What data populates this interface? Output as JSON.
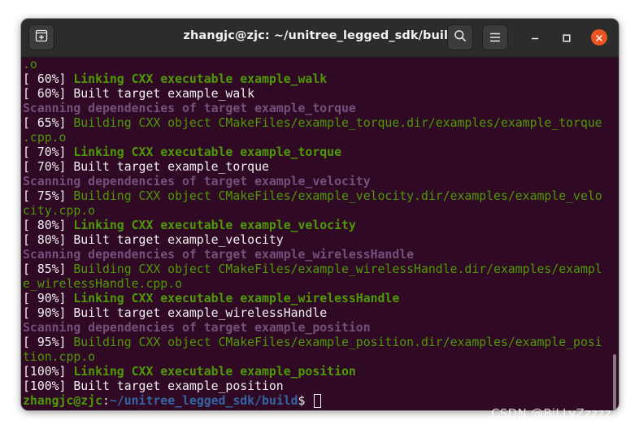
{
  "window": {
    "title": "zhangjc@zjc: ~/unitree_legged_sdk/build",
    "icons": {
      "new_tab": "new-tab-icon",
      "search": "search-icon",
      "menu": "hamburger-menu-icon",
      "minimize": "minimize-icon",
      "maximize": "maximize-icon",
      "close": "close-icon"
    },
    "colors": {
      "background": "#300a24",
      "green": "#4e9a06",
      "magenta": "#75507b",
      "blue": "#3465a4",
      "close": "#e95420"
    }
  },
  "terminal": {
    "lines": [
      {
        "prefix": "",
        "text": ".o",
        "style": "green"
      },
      {
        "prefix": "[ 60%] ",
        "text": "Linking CXX executable example_walk",
        "style": "green-bold"
      },
      {
        "prefix": "[ 60%] ",
        "text": "Built target example_walk",
        "style": "white"
      },
      {
        "prefix": "",
        "text": "Scanning dependencies of target example_torque",
        "style": "magenta"
      },
      {
        "prefix": "[ 65%] ",
        "text": "Building CXX object CMakeFiles/example_torque.dir/examples/example_torque",
        "style": "green"
      },
      {
        "prefix": "",
        "text": ".cpp.o",
        "style": "green"
      },
      {
        "prefix": "[ 70%] ",
        "text": "Linking CXX executable example_torque",
        "style": "green-bold"
      },
      {
        "prefix": "[ 70%] ",
        "text": "Built target example_torque",
        "style": "white"
      },
      {
        "prefix": "",
        "text": "Scanning dependencies of target example_velocity",
        "style": "magenta"
      },
      {
        "prefix": "[ 75%] ",
        "text": "Building CXX object CMakeFiles/example_velocity.dir/examples/example_velo",
        "style": "green"
      },
      {
        "prefix": "",
        "text": "city.cpp.o",
        "style": "green"
      },
      {
        "prefix": "[ 80%] ",
        "text": "Linking CXX executable example_velocity",
        "style": "green-bold"
      },
      {
        "prefix": "[ 80%] ",
        "text": "Built target example_velocity",
        "style": "white"
      },
      {
        "prefix": "",
        "text": "Scanning dependencies of target example_wirelessHandle",
        "style": "magenta"
      },
      {
        "prefix": "[ 85%] ",
        "text": "Building CXX object CMakeFiles/example_wirelessHandle.dir/examples/exampl",
        "style": "green"
      },
      {
        "prefix": "",
        "text": "e_wirelessHandle.cpp.o",
        "style": "green"
      },
      {
        "prefix": "[ 90%] ",
        "text": "Linking CXX executable example_wirelessHandle",
        "style": "green-bold"
      },
      {
        "prefix": "[ 90%] ",
        "text": "Built target example_wirelessHandle",
        "style": "white"
      },
      {
        "prefix": "",
        "text": "Scanning dependencies of target example_position",
        "style": "magenta"
      },
      {
        "prefix": "[ 95%] ",
        "text": "Building CXX object CMakeFiles/example_position.dir/examples/example_posi",
        "style": "green"
      },
      {
        "prefix": "",
        "text": "tion.cpp.o",
        "style": "green"
      },
      {
        "prefix": "[100%] ",
        "text": "Linking CXX executable example_position",
        "style": "green-bold"
      },
      {
        "prefix": "[100%] ",
        "text": "Built target example_position",
        "style": "white"
      }
    ],
    "prompt": {
      "user_host": "zhangjc@zjc",
      "separator": ":",
      "path": "~/unitree_legged_sdk/build",
      "symbol": "$ "
    }
  },
  "watermark": "CSDN @BiLLyZzzzz"
}
